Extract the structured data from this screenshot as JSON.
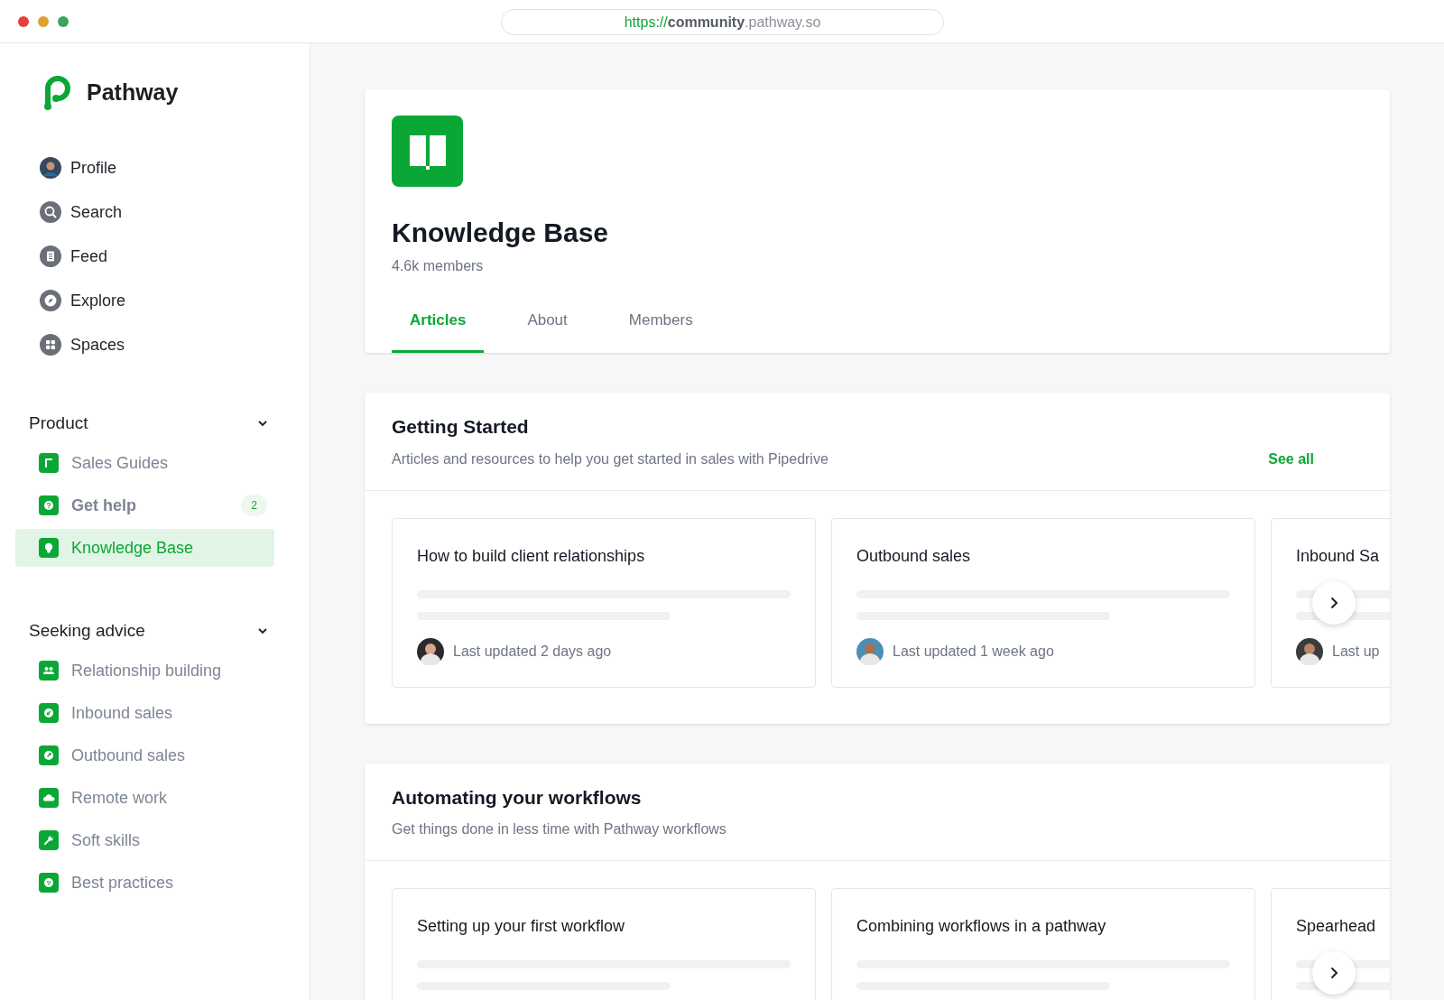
{
  "browser": {
    "url": [
      {
        "text": "https://",
        "kind": "scheme"
      },
      {
        "text": "community",
        "kind": "host"
      },
      {
        "text": ".pathway.so",
        "kind": "domain"
      }
    ]
  },
  "sidebar": {
    "brand": "Pathway",
    "nav": [
      {
        "label": "Profile"
      },
      {
        "label": "Search"
      },
      {
        "label": "Feed"
      },
      {
        "label": "Explore"
      },
      {
        "label": "Spaces"
      }
    ],
    "groups": [
      {
        "title": "Product",
        "expanded": true,
        "items": [
          {
            "label": "Sales Guides",
            "selected": false,
            "unread": false
          },
          {
            "label": "Get help",
            "selected": false,
            "unread": true,
            "badge": "2"
          },
          {
            "label": "Knowledge Base",
            "selected": true,
            "unread": false
          }
        ]
      },
      {
        "title": "Seeking advice",
        "expanded": true,
        "items": [
          {
            "label": "Relationship building",
            "selected": false,
            "unread": false
          },
          {
            "label": "Inbound sales",
            "selected": false,
            "unread": false
          },
          {
            "label": "Outbound sales",
            "selected": false,
            "unread": false
          },
          {
            "label": "Remote work",
            "selected": false,
            "unread": false
          },
          {
            "label": "Soft skills",
            "selected": false,
            "unread": false
          },
          {
            "label": "Best practices",
            "selected": false,
            "unread": false
          }
        ]
      }
    ]
  },
  "header": {
    "title": "Knowledge Base",
    "members": "4.6k members",
    "tabs": [
      {
        "label": "Articles",
        "selected": true
      },
      {
        "label": "About",
        "selected": false
      },
      {
        "label": "Members",
        "selected": false
      }
    ]
  },
  "sections": [
    {
      "title": "Getting Started",
      "subtitle": "Articles and resources to help you get started in sales with Pipedrive",
      "link": "See all",
      "cards": [
        {
          "title": "How to build client relationships",
          "updated": "Last updated 2 days ago"
        },
        {
          "title": "Outbound sales",
          "updated": "Last updated 1 week ago"
        },
        {
          "title": "Inbound Sa",
          "updated": "Last up"
        }
      ]
    },
    {
      "title": "Automating your workflows",
      "subtitle": "Get things done in less time with Pathway workflows",
      "cards": [
        {
          "title": "Setting up your first workflow"
        },
        {
          "title": "Combining workflows in a pathway"
        },
        {
          "title": "Spearhead"
        }
      ]
    }
  ]
}
